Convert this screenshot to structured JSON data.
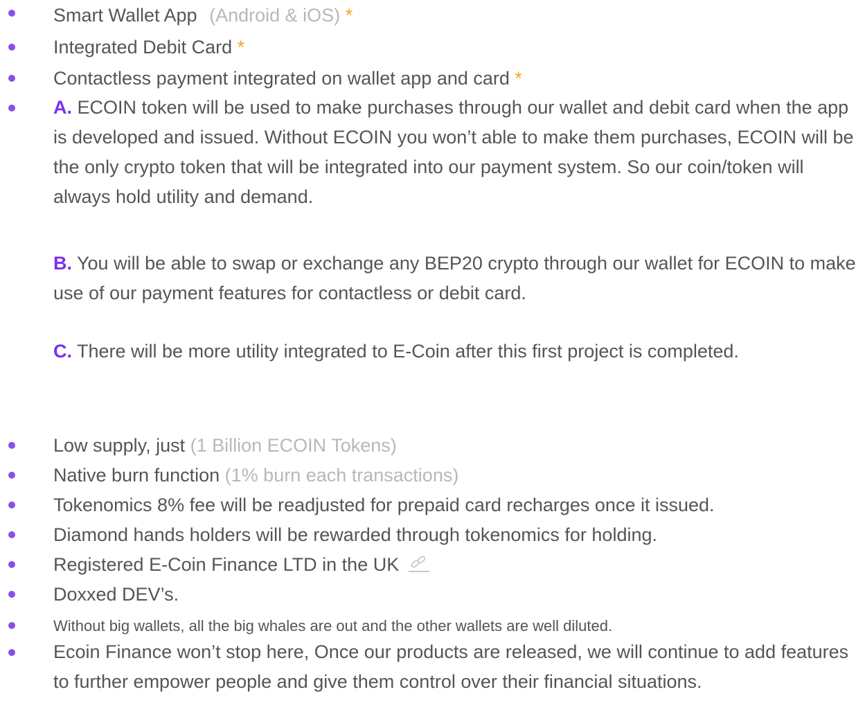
{
  "colors": {
    "bullet": "#8e4de6",
    "text": "#555555",
    "muted": "#b8b8b8",
    "star": "#f5a623",
    "letter": "#7b2ff2"
  },
  "features": {
    "item1": {
      "label": "Smart Wallet App",
      "note": "(Android & iOS)",
      "star": "*"
    },
    "item2": {
      "label": "Integrated Debit Card",
      "star": "*"
    },
    "item3": {
      "label": "Contactless payment integrated on wallet app and card",
      "star": "*"
    },
    "item4": {
      "a_letter": "A.",
      "a_text": "ECOIN token will be used to make purchases through our wallet and debit card when the app is developed and issued. Without ECOIN you won’t able to make them purchases, ECOIN will be the only crypto token that will be integrated into our payment system. So our coin/token will always hold utility and demand.",
      "b_letter": "B.",
      "b_text": "You will be able to swap or exchange any BEP20 crypto through our wallet for ECOIN to make use of our payment features for contactless or debit card.",
      "c_letter": "C.",
      "c_text": "There will be more utility integrated to E-Coin after this first project is completed."
    },
    "item5": {
      "label": "Low supply, just",
      "note": "(1 Billion ECOIN Tokens)"
    },
    "item6": {
      "label": "Native burn function",
      "note": "(1% burn each transactions)"
    },
    "item7": {
      "label": "Tokenomics 8% fee will be readjusted for prepaid card recharges once it issued."
    },
    "item8": {
      "label": "Diamond hands holders will be rewarded through tokenomics for holding."
    },
    "item9": {
      "label": "Registered E-Coin Finance LTD in the UK",
      "icon": "link-icon"
    },
    "item10": {
      "label": "Doxxed DEV’s."
    },
    "item11": {
      "label": "Without big wallets, all the big whales are out and the other wallets are well diluted."
    },
    "item12": {
      "label": "Ecoin Finance won’t stop here, Once our products are released, we will continue to add features to further empower people and give them control over their financial situations."
    }
  }
}
